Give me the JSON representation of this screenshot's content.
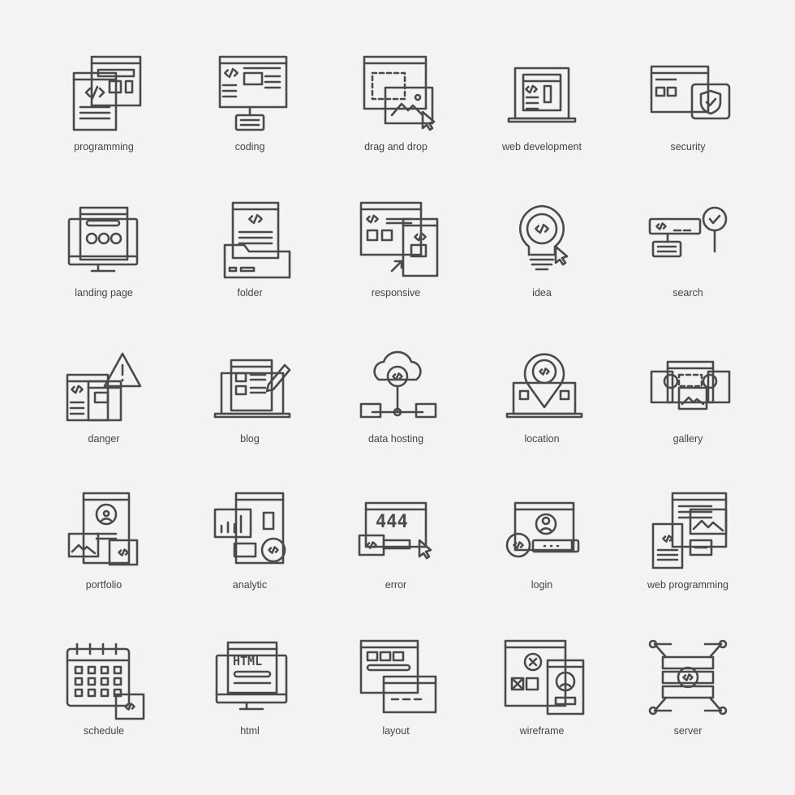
{
  "stroke_color": "#4a4a4a",
  "background_color": "#f3f3f3",
  "icons": [
    {
      "label": "programming",
      "icon": "programming-icon"
    },
    {
      "label": "coding",
      "icon": "coding-icon"
    },
    {
      "label": "drag and drop",
      "icon": "drag-and-drop-icon"
    },
    {
      "label": "web development",
      "icon": "web-development-icon"
    },
    {
      "label": "security",
      "icon": "security-icon"
    },
    {
      "label": "landing page",
      "icon": "landing-page-icon"
    },
    {
      "label": "folder",
      "icon": "folder-icon"
    },
    {
      "label": "responsive",
      "icon": "responsive-icon"
    },
    {
      "label": "idea",
      "icon": "idea-icon"
    },
    {
      "label": "search",
      "icon": "search-icon"
    },
    {
      "label": "danger",
      "icon": "danger-icon"
    },
    {
      "label": "blog",
      "icon": "blog-icon"
    },
    {
      "label": "data hosting",
      "icon": "data-hosting-icon"
    },
    {
      "label": "location",
      "icon": "location-icon"
    },
    {
      "label": "gallery",
      "icon": "gallery-icon"
    },
    {
      "label": "portfolio",
      "icon": "portfolio-icon"
    },
    {
      "label": "analytic",
      "icon": "analytic-icon"
    },
    {
      "label": "error",
      "icon": "error-icon",
      "text": "444"
    },
    {
      "label": "login",
      "icon": "login-icon"
    },
    {
      "label": "web programming",
      "icon": "web-programming-icon"
    },
    {
      "label": "schedule",
      "icon": "schedule-icon"
    },
    {
      "label": "html",
      "icon": "html-icon",
      "text": "HTML"
    },
    {
      "label": "layout",
      "icon": "layout-icon"
    },
    {
      "label": "wireframe",
      "icon": "wireframe-icon"
    },
    {
      "label": "server",
      "icon": "server-icon"
    }
  ]
}
